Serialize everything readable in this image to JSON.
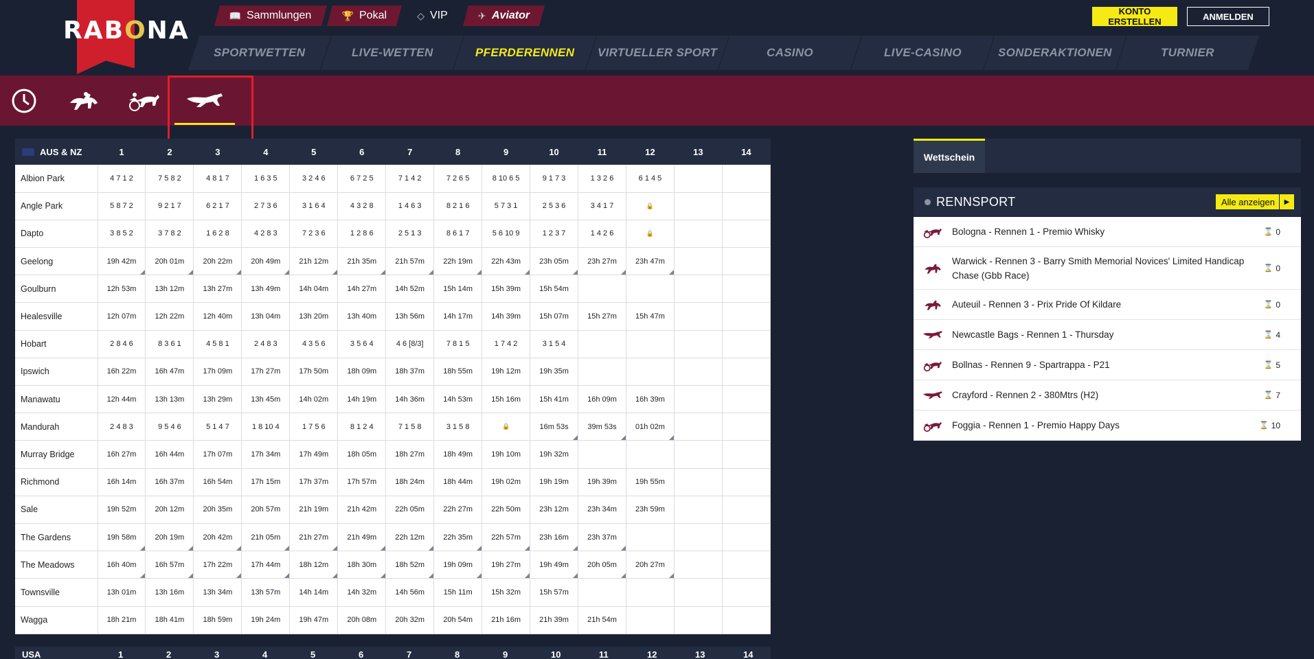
{
  "brand": {
    "logo": "RABONA"
  },
  "topnav": {
    "items": [
      {
        "label": "Sammlungen",
        "icon": "book-icon"
      },
      {
        "label": "Pokal",
        "icon": "trophy-icon"
      },
      {
        "label": "VIP",
        "icon": "diamond-icon"
      },
      {
        "label": "Aviator",
        "icon": "plane-icon"
      }
    ],
    "konto_label": "KONTO ERSTELLEN",
    "anmelden_label": "ANMELDEN"
  },
  "mainnav": {
    "tabs": [
      "SPORTWETTEN",
      "LIVE-WETTEN",
      "PFERDERENNEN",
      "VIRTUELLER SPORT",
      "CASINO",
      "LIVE-CASINO",
      "SONDERAKTIONEN",
      "TURNIER"
    ],
    "active": "PFERDERENNEN"
  },
  "subnav": {
    "icons": [
      "clock-icon",
      "horse-racing-icon",
      "harness-racing-icon",
      "greyhound-icon"
    ],
    "active": "greyhound-icon"
  },
  "schedule": {
    "region": "AUS & NZ",
    "columns": [
      "1",
      "2",
      "3",
      "4",
      "5",
      "6",
      "7",
      "8",
      "9",
      "10",
      "11",
      "12",
      "13",
      "14"
    ],
    "rows": [
      {
        "venue": "Albion Park",
        "cells": [
          "4 7 1 2",
          "7 5 8 2",
          "4 8 1 7",
          "1 6 3 5",
          "3 2 4 6",
          "6 7 2 5",
          "7 1 4 2",
          "7 2 6 5",
          "8 10 6 5",
          "9 1 7 3",
          "1 3 2 6",
          "6 1 4 5",
          "",
          ""
        ],
        "tri": []
      },
      {
        "venue": "Angle Park",
        "cells": [
          "5 8 7 2",
          "9 2 1 7",
          "6 2 1 7",
          "2 7 3 6",
          "3 1 6 4",
          "4 3 2 8",
          "1 4 6 3",
          "8 2 1 6",
          "5 7 3 1",
          "2 5 3 6",
          "3 4 1 7",
          "🔒",
          "",
          ""
        ],
        "tri": []
      },
      {
        "venue": "Dapto",
        "cells": [
          "3 8 5 2",
          "3 7 8 2",
          "1 6 2 8",
          "4 2 8 3",
          "7 2 3 6",
          "1 2 8 6",
          "2 5 1 3",
          "8 6 1 7",
          "5 6 10 9",
          "1 2 3 7",
          "1 4 2 6",
          "🔒",
          "",
          ""
        ],
        "tri": []
      },
      {
        "venue": "Geelong",
        "cells": [
          "19h 42m",
          "20h 01m",
          "20h 22m",
          "20h 49m",
          "21h 12m",
          "21h 35m",
          "21h 57m",
          "22h 19m",
          "22h 43m",
          "23h 05m",
          "23h 27m",
          "23h 47m",
          "",
          ""
        ],
        "tri": [
          0,
          1,
          2,
          3,
          4,
          5,
          6,
          7,
          8,
          9,
          10,
          11
        ]
      },
      {
        "venue": "Goulburn",
        "cells": [
          "12h 53m",
          "13h 12m",
          "13h 27m",
          "13h 49m",
          "14h 04m",
          "14h 27m",
          "14h 52m",
          "15h 14m",
          "15h 39m",
          "15h 54m",
          "",
          "",
          "",
          ""
        ],
        "tri": []
      },
      {
        "venue": "Healesville",
        "cells": [
          "12h 07m",
          "12h 22m",
          "12h 40m",
          "13h 04m",
          "13h 20m",
          "13h 40m",
          "13h 56m",
          "14h 17m",
          "14h 39m",
          "15h 07m",
          "15h 27m",
          "15h 47m",
          "",
          ""
        ],
        "tri": []
      },
      {
        "venue": "Hobart",
        "cells": [
          "2 8 4 6",
          "8 3 6 1",
          "4 5 8 1",
          "2 4 8 3",
          "4 3 5 6",
          "3 5 6 4",
          "4 6 [8/3]",
          "7 8 1 5",
          "1 7 4 2",
          "3 1 5 4",
          "",
          "",
          "",
          ""
        ],
        "tri": []
      },
      {
        "venue": "Ipswich",
        "cells": [
          "16h 22m",
          "16h 47m",
          "17h 09m",
          "17h 27m",
          "17h 50m",
          "18h 09m",
          "18h 37m",
          "18h 55m",
          "19h 12m",
          "19h 35m",
          "",
          "",
          "",
          ""
        ],
        "tri": []
      },
      {
        "venue": "Manawatu",
        "cells": [
          "12h 44m",
          "13h 13m",
          "13h 29m",
          "13h 45m",
          "14h 02m",
          "14h 19m",
          "14h 36m",
          "14h 53m",
          "15h 16m",
          "15h 41m",
          "16h 09m",
          "16h 39m",
          "",
          ""
        ],
        "tri": []
      },
      {
        "venue": "Mandurah",
        "cells": [
          "2 4 8 3",
          "9 5 4 6",
          "5 1 4 7",
          "1 8 10 4",
          "1 7 5 6",
          "8 1 2 4",
          "7 1 5 8",
          "3 1 5 8",
          "🔒",
          "16m 53s",
          "39m 53s",
          "01h 02m",
          "",
          ""
        ],
        "tri": [
          9,
          10,
          11
        ]
      },
      {
        "venue": "Murray Bridge",
        "cells": [
          "16h 27m",
          "16h 44m",
          "17h 07m",
          "17h 34m",
          "17h 49m",
          "18h 05m",
          "18h 27m",
          "18h 49m",
          "19h 10m",
          "19h 32m",
          "",
          "",
          "",
          ""
        ],
        "tri": []
      },
      {
        "venue": "Richmond",
        "cells": [
          "16h 14m",
          "16h 37m",
          "16h 54m",
          "17h 15m",
          "17h 37m",
          "17h 57m",
          "18h 24m",
          "18h 44m",
          "19h 02m",
          "19h 19m",
          "19h 39m",
          "19h 55m",
          "",
          ""
        ],
        "tri": []
      },
      {
        "venue": "Sale",
        "cells": [
          "19h 52m",
          "20h 12m",
          "20h 35m",
          "20h 57m",
          "21h 19m",
          "21h 42m",
          "22h 05m",
          "22h 27m",
          "22h 50m",
          "23h 12m",
          "23h 34m",
          "23h 59m",
          "",
          ""
        ],
        "tri": []
      },
      {
        "venue": "The Gardens",
        "cells": [
          "19h 58m",
          "20h 19m",
          "20h 42m",
          "21h 05m",
          "21h 27m",
          "21h 49m",
          "22h 12m",
          "22h 35m",
          "22h 57m",
          "23h 16m",
          "23h 37m",
          "",
          "",
          ""
        ],
        "tri": [
          0,
          1,
          2,
          3,
          4,
          5,
          6,
          7,
          8,
          9,
          10
        ]
      },
      {
        "venue": "The Meadows",
        "cells": [
          "16h 40m",
          "16h 57m",
          "17h 22m",
          "17h 44m",
          "18h 12m",
          "18h 30m",
          "18h 52m",
          "19h 09m",
          "19h 27m",
          "19h 49m",
          "20h 05m",
          "20h 27m",
          "",
          ""
        ],
        "tri": [
          0,
          1,
          2,
          3,
          4,
          5,
          6,
          7,
          8,
          9,
          10,
          11
        ]
      },
      {
        "venue": "Townsville",
        "cells": [
          "13h 01m",
          "13h 16m",
          "13h 34m",
          "13h 57m",
          "14h 14m",
          "14h 32m",
          "14h 56m",
          "15h 11m",
          "15h 32m",
          "15h 57m",
          "",
          "",
          "",
          ""
        ],
        "tri": []
      },
      {
        "venue": "Wagga",
        "cells": [
          "18h 21m",
          "18h 41m",
          "18h 59m",
          "19h 24m",
          "19h 47m",
          "20h 08m",
          "20h 32m",
          "20h 54m",
          "21h 16m",
          "21h 39m",
          "21h 54m",
          "",
          "",
          ""
        ],
        "tri": []
      }
    ],
    "next_region": "USA"
  },
  "betslip": {
    "tab_label": "Wettschein"
  },
  "rennsport": {
    "title": "RENNSPORT",
    "all_label": "Alle anzeigen",
    "items": [
      {
        "name": "Bologna - Rennen 1 - Premio Whisky",
        "count": "0",
        "icon": "harness-racing-icon"
      },
      {
        "name": "Warwick - Rennen 3 - Barry Smith Memorial Novices' Limited Handicap Chase (Gbb Race)",
        "count": "0",
        "icon": "horse-racing-icon"
      },
      {
        "name": "Auteuil - Rennen 3 - Prix Pride Of Kildare",
        "count": "0",
        "icon": "horse-racing-icon"
      },
      {
        "name": "Newcastle Bags - Rennen 1 - Thursday",
        "count": "4",
        "icon": "greyhound-icon"
      },
      {
        "name": "Bollnas - Rennen 9 - Spartrappa - P21",
        "count": "5",
        "icon": "harness-racing-icon"
      },
      {
        "name": "Crayford - Rennen 2 - 380Mtrs (H2)",
        "count": "7",
        "icon": "greyhound-icon"
      },
      {
        "name": "Foggia - Rennen 1 - Premio Happy Days",
        "count": "10",
        "icon": "harness-racing-icon"
      }
    ]
  }
}
